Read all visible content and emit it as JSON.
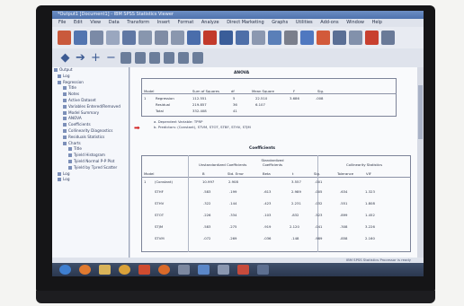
{
  "window": {
    "title": "*Output1 [Document1] - IBM SPSS Statistics Viewer"
  },
  "menu": [
    "File",
    "Edit",
    "View",
    "Data",
    "Transform",
    "Insert",
    "Format",
    "Analyze",
    "Direct Marketing",
    "Graphs",
    "Utilities",
    "Add-ons",
    "Window",
    "Help"
  ],
  "tree": [
    {
      "label": "Output",
      "level": 0
    },
    {
      "label": "Log",
      "level": 1
    },
    {
      "label": "Regression",
      "level": 1
    },
    {
      "label": "Title",
      "level": 2
    },
    {
      "label": "Notes",
      "level": 2
    },
    {
      "label": "Active Dataset",
      "level": 2
    },
    {
      "label": "Variables Entered/Removed",
      "level": 2
    },
    {
      "label": "Model Summary",
      "level": 2
    },
    {
      "label": "ANOVA",
      "level": 2
    },
    {
      "label": "Coefficients",
      "level": 2
    },
    {
      "label": "Collinearity Diagnostics",
      "level": 2
    },
    {
      "label": "Residuals Statistics",
      "level": 2
    },
    {
      "label": "Charts",
      "level": 2
    },
    {
      "label": "Title",
      "level": 3
    },
    {
      "label": "Tyield Histogram",
      "level": 3
    },
    {
      "label": "Tyield Normal P-P Plot",
      "level": 3
    },
    {
      "label": "Tyield by Tpred Scatter",
      "level": 3
    },
    {
      "label": "Log",
      "level": 1
    },
    {
      "label": "Log",
      "level": 1
    }
  ],
  "anova": {
    "caption": "ANOVA",
    "headers": [
      "Model",
      "Sum of Squares",
      "df",
      "Mean Square",
      "F",
      "Sig."
    ],
    "rows": [
      [
        "1",
        "Regression",
        "112.551",
        "5",
        "22.510",
        "3.686",
        ".008"
      ],
      [
        "",
        "Residual",
        "219.857",
        "36",
        "6.107",
        "",
        ""
      ],
      [
        "",
        "Total",
        "332.408",
        "41",
        "",
        "",
        ""
      ]
    ],
    "notes": [
      "a. Dependent Variable: TPRP",
      "b. Predictors: (Constant), STVM, STOT, STBF, STHV, STJM"
    ]
  },
  "coefficients": {
    "caption": "Coefficients",
    "group_headers": [
      "Unstandardized Coefficients",
      "Standardized Coefficients",
      "Collinearity Statistics"
    ],
    "headers": [
      "Model",
      "",
      "B",
      "Std. Error",
      "Beta",
      "t",
      "Sig.",
      "Tolerance",
      "VIF"
    ],
    "rows": [
      [
        "1",
        "(Constant)",
        "10.997",
        "2.908",
        "",
        "3.557",
        ".001",
        "",
        ""
      ],
      [
        "",
        "STHF",
        ".583",
        ".199",
        ".613",
        "2.989",
        ".005",
        ".634",
        "1.323"
      ],
      [
        "",
        "STHV",
        ".322",
        ".144",
        ".423",
        "2.231",
        ".032",
        ".551",
        "1.808"
      ],
      [
        "",
        "STOT",
        ".226",
        ".334",
        ".103",
        ".832",
        ".523",
        ".899",
        "1.452"
      ],
      [
        "",
        "STJM",
        ".583",
        ".275",
        ".919",
        "2.120",
        ".041",
        ".308",
        "3.226"
      ],
      [
        "",
        "STVM",
        ".072",
        ".269",
        ".036",
        ".148",
        ".989",
        ".858",
        "2.160"
      ]
    ]
  },
  "status": {
    "text": "IBM SPSS Statistics Processor is ready"
  },
  "colors": {
    "title_bar": "#4e72ad",
    "highlight_arrow": "#d32020"
  }
}
